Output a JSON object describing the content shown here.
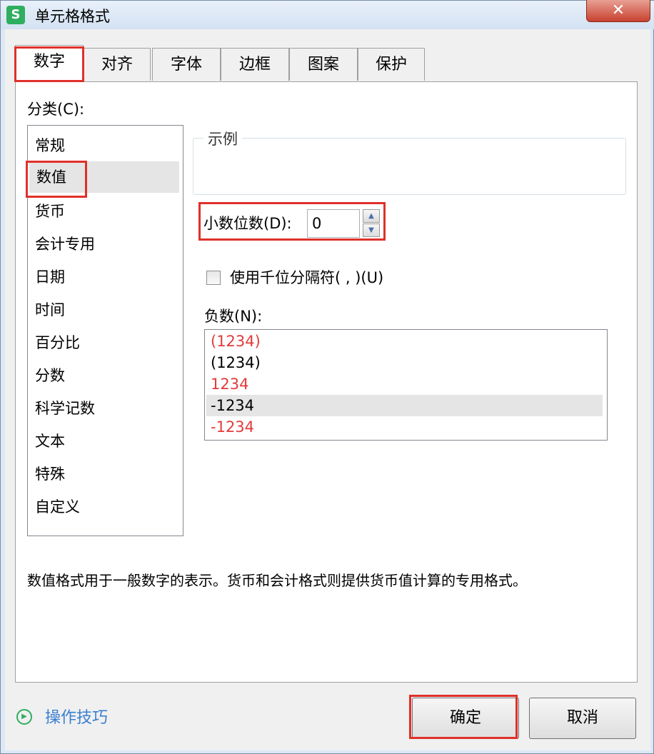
{
  "window": {
    "title": "单元格格式",
    "app_icon": "S"
  },
  "tabs": [
    {
      "label": "数字",
      "active": true
    },
    {
      "label": "对齐",
      "active": false
    },
    {
      "label": "字体",
      "active": false
    },
    {
      "label": "边框",
      "active": false
    },
    {
      "label": "图案",
      "active": false
    },
    {
      "label": "保护",
      "active": false
    }
  ],
  "category": {
    "label": "分类(C):",
    "items": [
      "常规",
      "数值",
      "货币",
      "会计专用",
      "日期",
      "时间",
      "百分比",
      "分数",
      "科学记数",
      "文本",
      "特殊",
      "自定义"
    ],
    "selected": "数值"
  },
  "sample": {
    "label": "示例",
    "value": ""
  },
  "decimals": {
    "label": "小数位数(D):",
    "value": "0"
  },
  "thousands_separator": {
    "label": "使用千位分隔符( , )(U)",
    "checked": false
  },
  "negative": {
    "label": "负数(N):",
    "items": [
      {
        "text": "(1234)",
        "color": "#e23b3b"
      },
      {
        "text": "(1234)",
        "color": "#000000"
      },
      {
        "text": "1234",
        "color": "#e23b3b"
      },
      {
        "text": "-1234",
        "color": "#000000",
        "selected": true
      },
      {
        "text": "-1234",
        "color": "#e23b3b"
      }
    ]
  },
  "description": "数值格式用于一般数字的表示。货币和会计格式则提供货币值计算的专用格式。",
  "footer": {
    "tips_label": "操作技巧",
    "ok_label": "确定",
    "cancel_label": "取消"
  },
  "colors": {
    "highlight": "#e0302a",
    "negative_red": "#e23b3b",
    "link_blue": "#3a7fd0",
    "app_green": "#2fae5f"
  }
}
